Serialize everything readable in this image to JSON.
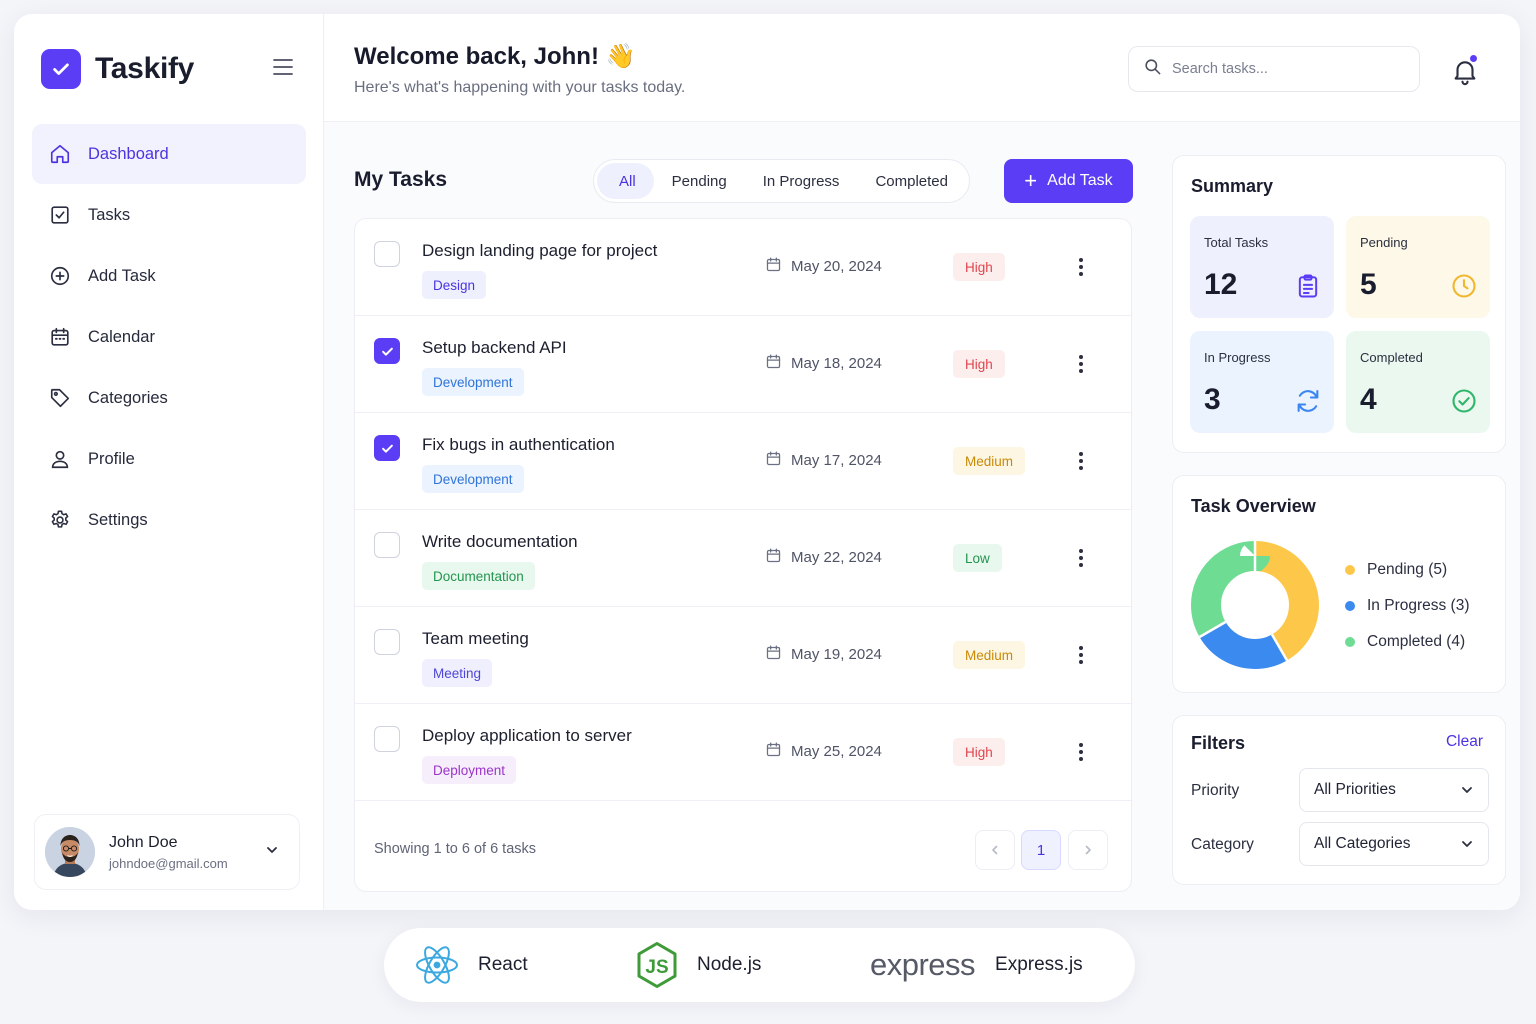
{
  "brand": {
    "name": "Taskify",
    "accent": "#5b3df5"
  },
  "sidebar": {
    "items": [
      {
        "label": "Dashboard",
        "icon": "home-icon",
        "active": true
      },
      {
        "label": "Tasks",
        "icon": "checkbox-icon"
      },
      {
        "label": "Add Task",
        "icon": "plus-circle-icon"
      },
      {
        "label": "Calendar",
        "icon": "calendar-icon"
      },
      {
        "label": "Categories",
        "icon": "tag-icon"
      },
      {
        "label": "Profile",
        "icon": "user-icon"
      },
      {
        "label": "Settings",
        "icon": "gear-icon"
      }
    ],
    "user": {
      "name": "John Doe",
      "email": "johndoe@gmail.com"
    }
  },
  "header": {
    "welcome": "Welcome back, John! 👋",
    "subtitle": "Here's what's happening with your tasks today.",
    "search_placeholder": "Search tasks...",
    "has_notification": true
  },
  "tasks_panel": {
    "title": "My Tasks",
    "tabs": [
      "All",
      "Pending",
      "In Progress",
      "Completed"
    ],
    "active_tab": "All",
    "add_button": "Add Task",
    "tasks": [
      {
        "title": "Design landing page for project",
        "category": "Design",
        "date": "May 20, 2024",
        "priority": "High",
        "checked": false
      },
      {
        "title": "Setup backend API",
        "category": "Development",
        "date": "May 18, 2024",
        "priority": "High",
        "checked": true
      },
      {
        "title": "Fix bugs in authentication",
        "category": "Development",
        "date": "May 17, 2024",
        "priority": "Medium",
        "checked": true
      },
      {
        "title": "Write documentation",
        "category": "Documentation",
        "date": "May 22, 2024",
        "priority": "Low",
        "checked": false
      },
      {
        "title": "Team meeting",
        "category": "Meeting",
        "date": "May 19, 2024",
        "priority": "Medium",
        "checked": false
      },
      {
        "title": "Deploy application to server",
        "category": "Deployment",
        "date": "May 25, 2024",
        "priority": "High",
        "checked": false
      }
    ],
    "footer": {
      "showing": "Showing 1 to 6 of 6 tasks",
      "current_page": "1"
    }
  },
  "summary": {
    "title": "Summary",
    "cards": [
      {
        "label": "Total Tasks",
        "value": "12",
        "icon": "clipboard-icon",
        "bg": "#eef0fd",
        "color": "#5b3df5"
      },
      {
        "label": "Pending",
        "value": "5",
        "icon": "clock-icon",
        "bg": "#fdf8e8",
        "color": "#f0b72f"
      },
      {
        "label": "In Progress",
        "value": "3",
        "icon": "refresh-icon",
        "bg": "#ebf4fe",
        "color": "#3b86f0"
      },
      {
        "label": "Completed",
        "value": "4",
        "icon": "check-circle-icon",
        "bg": "#eaf8ef",
        "color": "#2fb66a"
      }
    ]
  },
  "overview": {
    "title": "Task Overview",
    "legend": [
      "Pending (5)",
      "In Progress (3)",
      "Completed (4)"
    ],
    "colors": [
      "#fdc84a",
      "#3b8af0",
      "#6fdc94"
    ]
  },
  "chart_data": {
    "type": "pie",
    "categories": [
      "Pending",
      "In Progress",
      "Completed"
    ],
    "values": [
      5,
      3,
      4
    ],
    "title": "Task Overview"
  },
  "filters": {
    "title": "Filters",
    "clear": "Clear",
    "priority_label": "Priority",
    "priority_value": "All Priorities",
    "category_label": "Category",
    "category_value": "All Categories"
  },
  "tech_stack": [
    {
      "name": "React",
      "icon": "react-icon"
    },
    {
      "name": "Node.js",
      "icon": "nodejs-icon"
    },
    {
      "name": "Express.js",
      "icon": "express-logo",
      "logo_text": "express"
    }
  ],
  "category_styles": {
    "Design": {
      "bg": "#eef0fd",
      "fg": "#4b34e0"
    },
    "Development": {
      "bg": "#eaf3fe",
      "fg": "#2f74d8"
    },
    "Documentation": {
      "bg": "#e9f8ee",
      "fg": "#23954f"
    },
    "Meeting": {
      "bg": "#efeffd",
      "fg": "#4e46d8"
    },
    "Deployment": {
      "bg": "#f7eefc",
      "fg": "#9b35c9"
    }
  },
  "priority_styles": {
    "High": {
      "bg": "#fdeeee",
      "fg": "#e0454d"
    },
    "Medium": {
      "bg": "#fdf6e2",
      "fg": "#c98a06"
    },
    "Low": {
      "bg": "#e9f8ee",
      "fg": "#23954f"
    }
  }
}
